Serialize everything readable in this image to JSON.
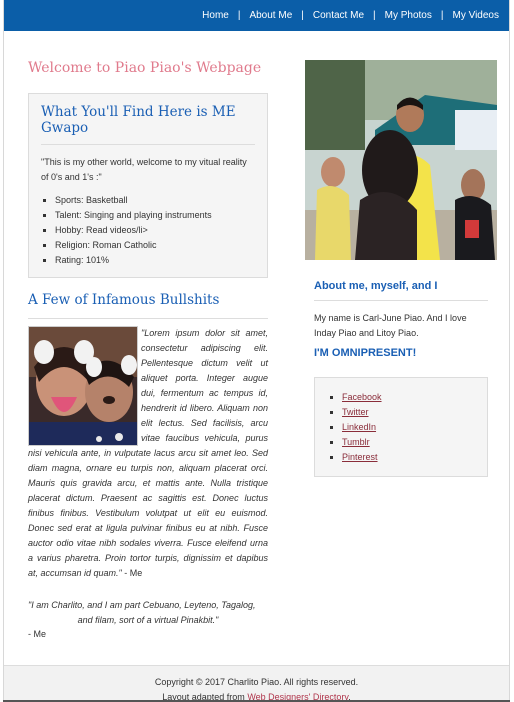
{
  "nav": {
    "items": [
      "Home",
      "About Me",
      "Contact Me",
      "My Photos",
      "My Videos"
    ],
    "separator": "|"
  },
  "main": {
    "welcome_title": "Welcome to Piao Piao's Webpage",
    "find_box": {
      "title": "What You'll Find Here is ME Gwapo",
      "intro": "\"This is my other world, welcome to my vitual reality of 0's and 1's :\"",
      "list": [
        "Sports: Basketball",
        "Talent: Singing and playing instruments",
        "Hobby: Read videos/li>",
        "Religion: Roman Catholic",
        "Rating: 101%"
      ]
    },
    "bullshits": {
      "title": "A Few of Infamous Bullshits",
      "quote1": "\"Lorem ipsum dolor sit amet, consectetur adipiscing elit. Pellentesque dictum velit ut aliquet porta. Integer augue dui, fermentum ac tempus id, hendrerit id libero. Aliquam non elit lectus. Sed facilisis, arcu vitae faucibus vehicula, purus nisi vehicula ante, in vulputate lacus arcu sit amet leo. Sed diam magna, ornare eu turpis non, aliquam placerat orci. Mauris quis gravida arcu, et mattis ante. Nulla tristique placerat dictum. Praesent ac sagittis est. Donec luctus finibus finibus. Vestibulum volutpat ut elit eu euismod. Donec sed erat at ligula pulvinar finibus eu at nibh. Fusce auctor odio vitae nibh sodales viverra. Fusce eleifend urna a varius pharetra. Proin tortor turpis, dignissim et dapibus at, accumsan id quam.\"",
      "quote1_attr": " - Me",
      "quote2_line1": "\"I am Charlito, and I am part Cebuano, Leyteno, Tagalog,",
      "quote2_line2": "and filam, sort of a virtual Pinakbit.\"",
      "quote2_attr": "- Me"
    }
  },
  "sidebar": {
    "about_title": "About me, myself, and I",
    "about_text": "My name is Carl-June Piao. And I love Inday Piao and Litoy Piao.",
    "omni_title": "I'M OMNIPRESENT!",
    "links": [
      "Facebook",
      "Twitter",
      "LinkedIn",
      "Tumblr",
      "Pinterest"
    ]
  },
  "footer": {
    "copyright": "Copyright © 2017 Charlito Piao. All rights reserved.",
    "adapted_prefix": "Layout adapted from ",
    "adapted_link": "Web Designers' Directory",
    "adapted_suffix": "."
  },
  "colors": {
    "nav_bg": "#0b5ea8",
    "welcome": "#e07a8c",
    "heading_blue": "#1a5fb4",
    "link": "#8a2d3a"
  }
}
